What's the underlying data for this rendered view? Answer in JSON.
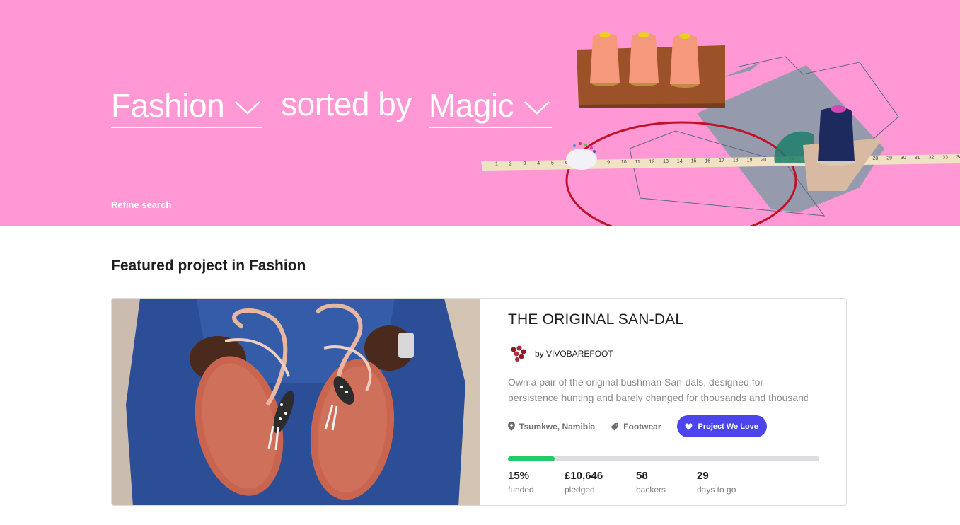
{
  "hero": {
    "category_label": "Fashion",
    "connector_text": "sorted by",
    "sort_label": "Magic",
    "refine_label": "Refine search",
    "background_color": "#ff98d5",
    "tape_numbers": [
      "1",
      "2",
      "3",
      "4",
      "5",
      "6",
      "7",
      "8",
      "9",
      "10",
      "11",
      "12",
      "13",
      "14",
      "15",
      "16",
      "17",
      "18",
      "19",
      "20",
      "21",
      "22",
      "23",
      "24",
      "25",
      "26",
      "27",
      "28",
      "29",
      "30",
      "31",
      "32",
      "33",
      "34"
    ]
  },
  "featured": {
    "section_title": "Featured project in Fashion",
    "project_title": "THE ORIGINAL SAN-DAL",
    "creator": "by VIVOBAREFOOT",
    "blurb_line1": "Own a pair of the original bushman San-dals, designed for",
    "blurb_line2": "persistence hunting and barely changed for thousands and thousands of years.",
    "location": "Tsumkwe, Namibia",
    "category": "Footwear",
    "badge": "Project We Love",
    "funded_fraction": 0.15,
    "stats": [
      {
        "value": "15%",
        "label": "funded"
      },
      {
        "value": "£10,646",
        "label": "pledged"
      },
      {
        "value": "58",
        "label": "backers"
      },
      {
        "value": "29",
        "label": "days to go"
      }
    ],
    "accent_color": "#4c45ec",
    "progress_color": "#25cb68"
  }
}
